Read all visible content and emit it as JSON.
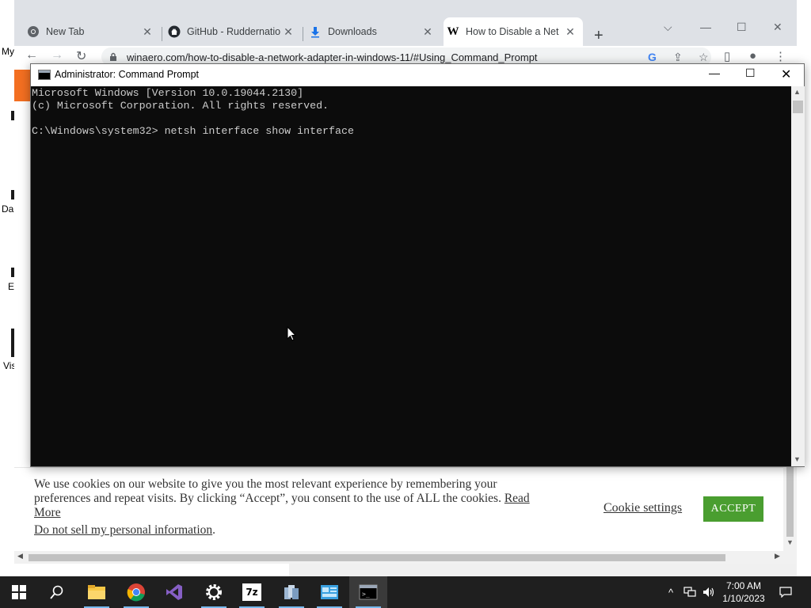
{
  "desktop": {
    "labels": [
      "My",
      "Da",
      "E",
      "Vis"
    ]
  },
  "browser": {
    "tabs": [
      {
        "title": "New Tab",
        "icon": "chrome-icon"
      },
      {
        "title": "GitHub - Ruddernatio",
        "icon": "github-icon"
      },
      {
        "title": "Downloads",
        "icon": "download-icon"
      },
      {
        "title": "How to Disable a Net",
        "icon": "winaero-icon",
        "active": true
      }
    ],
    "url": "winaero.com/how-to-disable-a-network-adapter-in-windows-11/#Using_Command_Prompt",
    "cookie_banner": {
      "text": "We use cookies on our website to give you the most relevant experience by remembering your preferences and repeat visits. By clicking “Accept”, you consent to the use of ALL the cookies.",
      "read_more": "Read More",
      "do_not_sell": "Do not sell my personal information",
      "do_not_sell_suffix": ".",
      "settings_label": "Cookie settings",
      "accept_label": "ACCEPT",
      "accept_color": "#4a9e30"
    }
  },
  "cmd": {
    "title": "Administrator: Command Prompt",
    "lines": [
      "Microsoft Windows [Version 10.0.19044.2130]",
      "(c) Microsoft Corporation. All rights reserved.",
      "",
      "C:\\Windows\\system32> netsh interface show interface"
    ]
  },
  "taskbar": {
    "apps": [
      "start-icon",
      "search-icon",
      "file-explorer-icon",
      "chrome-icon",
      "visual-studio-icon",
      "settings-icon",
      "7zip-icon",
      "app-icon",
      "control-panel-icon",
      "cmd-icon"
    ],
    "clock": {
      "time": "7:00 AM",
      "date": "1/10/2023"
    }
  }
}
